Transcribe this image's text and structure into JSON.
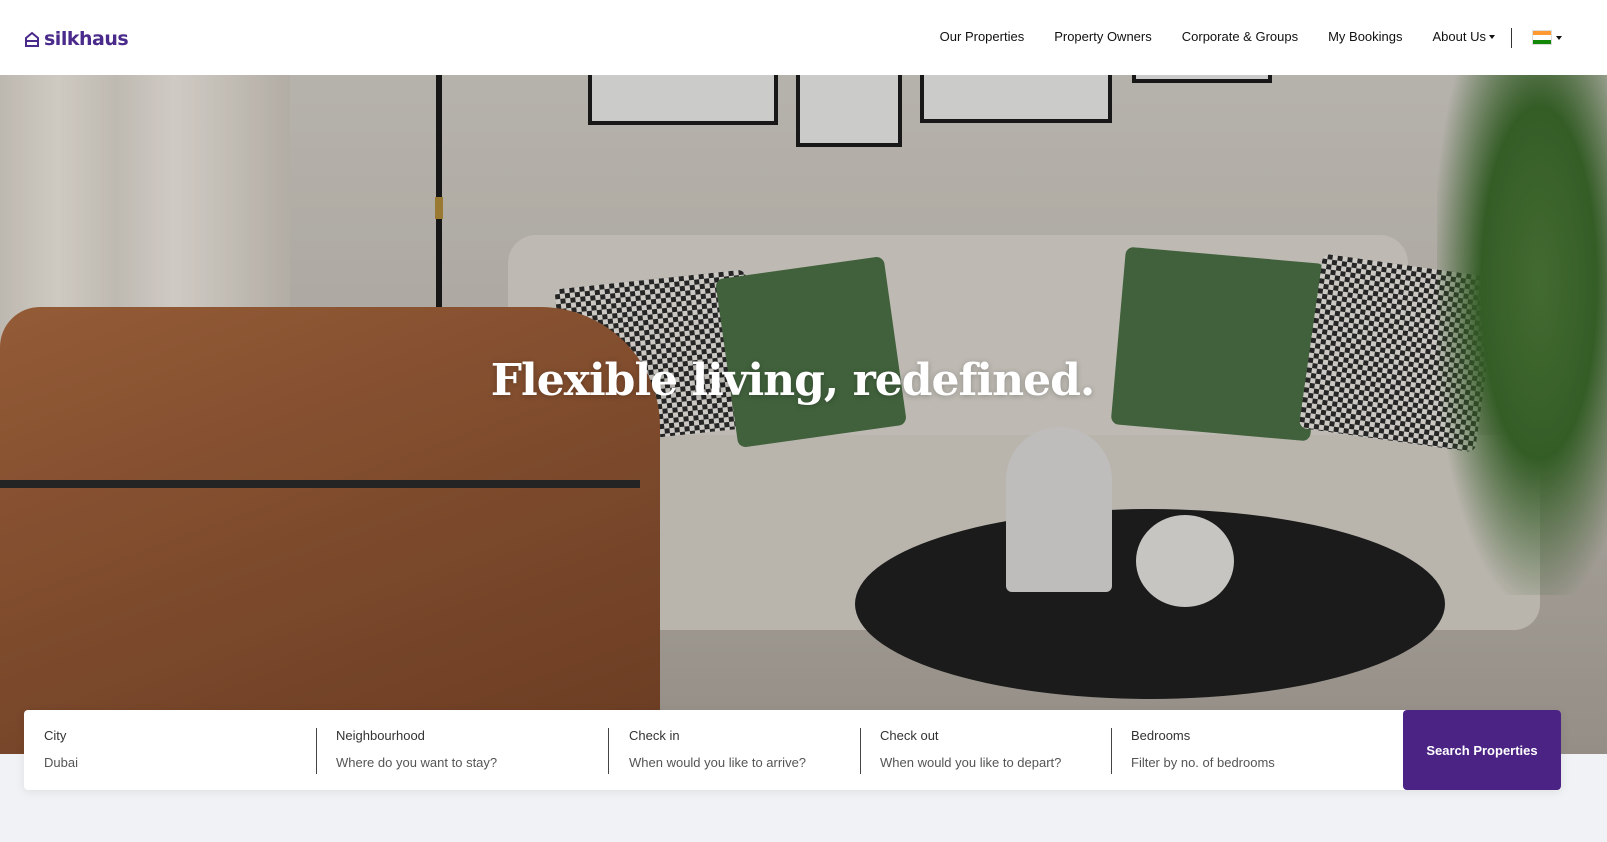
{
  "brand": {
    "name": "silkhaus",
    "color": "#4a2a8a"
  },
  "nav": {
    "items": [
      {
        "label": "Our Properties"
      },
      {
        "label": "Property Owners"
      },
      {
        "label": "Corporate & Groups"
      },
      {
        "label": "My Bookings"
      },
      {
        "label": "About Us"
      }
    ],
    "language_flag": "india-flag-icon"
  },
  "hero": {
    "title": "Flexible living, redefined."
  },
  "search": {
    "fields": [
      {
        "label": "City",
        "value": "Dubai"
      },
      {
        "label": "Neighbourhood",
        "value": "Where do you want to stay?"
      },
      {
        "label": "Check in",
        "value": "When would you like to arrive?"
      },
      {
        "label": "Check out",
        "value": "When would you like to depart?"
      },
      {
        "label": "Bedrooms",
        "value": "Filter by no. of bedrooms"
      }
    ],
    "button_label": "Search Properties",
    "button_color": "#4b2385"
  }
}
